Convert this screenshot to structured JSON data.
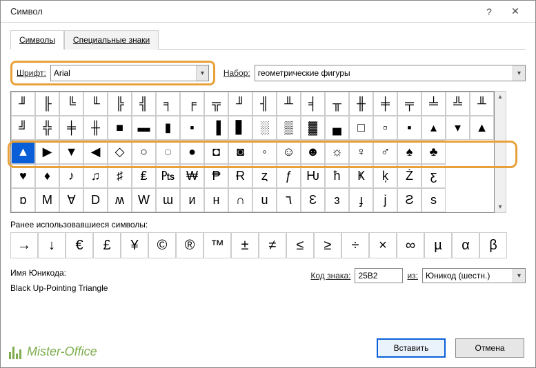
{
  "title": "Символ",
  "tabs": {
    "symbols": "Символы",
    "specials": "Специальные знаки"
  },
  "font": {
    "label": "Шрифт:",
    "value": "Arial"
  },
  "set": {
    "label": "Набор:",
    "value": "геометрические фигуры"
  },
  "grid_rows": [
    [
      "╜",
      "╟",
      "╚",
      "╙",
      "╠",
      "╣",
      "╕",
      "╒",
      "╦",
      "╜",
      "╢",
      "╨",
      "╡",
      "╥",
      "╫",
      "╪",
      "╤",
      "╧",
      "╩",
      "╨"
    ],
    [
      "╝",
      "╬",
      "╪",
      "╫",
      "■",
      "▬",
      "▮",
      "▪",
      "▐",
      "▋",
      "░",
      "▒",
      "▓",
      "▄",
      "□",
      "▫",
      "▪",
      "▴",
      "▾",
      "▲"
    ],
    [
      "▲",
      "▶",
      "▼",
      "◀",
      "◇",
      "○",
      "◌",
      "●",
      "◘",
      "◙",
      "◦",
      "☺",
      "☻",
      "☼",
      "♀",
      "♂",
      "♠",
      "♣"
    ],
    [
      "♥",
      "♦",
      "♪",
      "♫",
      "♯",
      "₤",
      "₧",
      "₩",
      "₱",
      "Ɍ",
      "ȥ",
      "ƒ",
      "Ƕ",
      "ħ",
      "Ҝ",
      "ķ",
      "Ż",
      "ƹ"
    ],
    [
      "ɒ",
      "M",
      "Ɐ",
      "D",
      "ʍ",
      "W",
      "ɯ",
      "и",
      "н",
      "∩",
      "u",
      "٦",
      "Ɛ",
      "ɜ",
      "ɟ",
      "j",
      "Ƨ",
      "s"
    ]
  ],
  "selected_pos": {
    "row": 2,
    "col": 0
  },
  "recent_label": "Ранее использовавшиеся символы:",
  "recent": [
    "→",
    "↓",
    "€",
    "£",
    "¥",
    "©",
    "®",
    "™",
    "±",
    "≠",
    "≤",
    "≥",
    "÷",
    "×",
    "∞",
    "µ",
    "α",
    "β"
  ],
  "unicode_label": "Имя Юникода:",
  "unicode_name": "Black Up-Pointing Triangle",
  "code_label": "Код знака:",
  "code_value": "25B2",
  "from_label": "из:",
  "from_value": "Юникод (шестн.)",
  "btn_insert": "Вставить",
  "btn_cancel": "Отмена",
  "watermark": "Mister-Office"
}
